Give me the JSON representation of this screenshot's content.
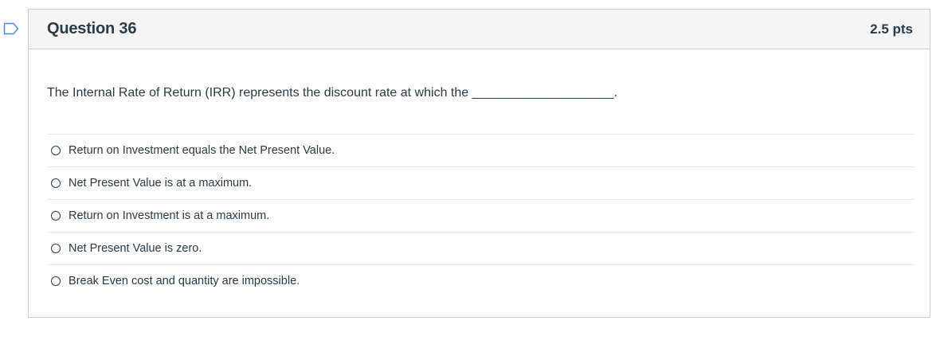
{
  "question": {
    "title": "Question 36",
    "points": "2.5 pts",
    "text": "The Internal Rate of Return (IRR) represents the discount rate at which the ____________________.",
    "answers": [
      {
        "label": "Return on Investment equals the Net Present Value."
      },
      {
        "label": "Net Present Value is at a maximum."
      },
      {
        "label": "Return on Investment is at a maximum."
      },
      {
        "label": "Net Present Value is zero."
      },
      {
        "label": "Break Even cost and quantity are impossible."
      }
    ]
  },
  "colors": {
    "text": "#2d3b45",
    "border": "#c7cdd1",
    "header_bg": "#f5f5f5",
    "divider": "#e6e8ea",
    "flag": "#4a90d9"
  },
  "icons": {
    "flag": "flag-icon",
    "radio": "radio-button"
  }
}
